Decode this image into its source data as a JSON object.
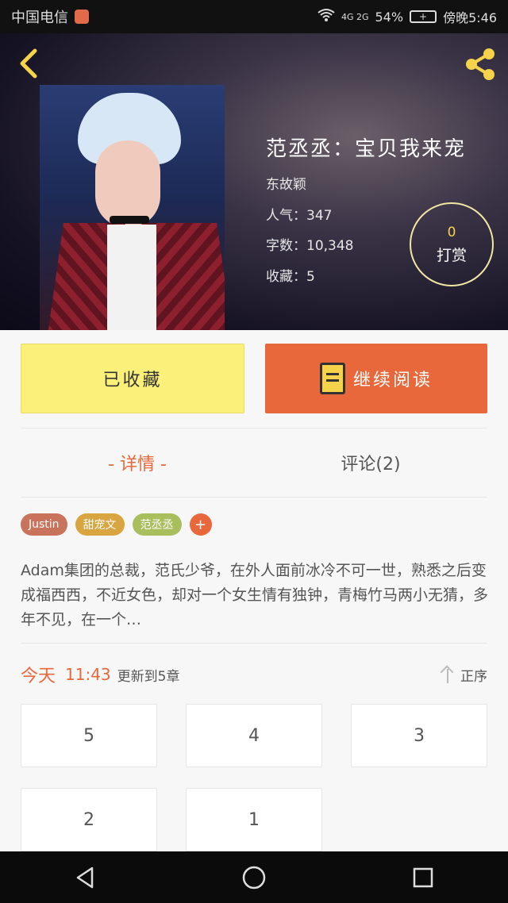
{
  "status_bar": {
    "carrier": "中国电信",
    "network": "4G 2G",
    "battery_percent": "54%",
    "time": "傍晚5:46"
  },
  "book": {
    "title": "范丞丞：宝贝我来宠",
    "author": "东故颖",
    "popularity": "人气：347",
    "word_count": "字数：10,348",
    "favorites": "收藏：5",
    "reward_count": "0",
    "reward_label": "打赏"
  },
  "actions": {
    "collected_label": "已收藏",
    "read_label": "继续阅读"
  },
  "tabs": {
    "detail_label": "- 详情 -",
    "comments_label": "评论(2)"
  },
  "tags": [
    {
      "label": "Justin",
      "color": "#c9735c"
    },
    {
      "label": "甜宠文",
      "color": "#d9a540"
    },
    {
      "label": "范丞丞",
      "color": "#a9be5c"
    }
  ],
  "tag_add_label": "+",
  "summary": "Adam集团的总裁，范氏少爷，在外人面前冰冷不可一世，熟悉之后变成福西西，不近女色，却对一个女生情有独钟，青梅竹马两小无猜，多年不见，在一个…",
  "update": {
    "day": "今天",
    "time": "11:43",
    "text": "更新到5章",
    "sort_label": "正序"
  },
  "chapters": [
    "5",
    "4",
    "3",
    "2",
    "1"
  ],
  "colors": {
    "accent": "#e8673b",
    "collected_bg": "#fbf07a",
    "reward_ring": "#f2e7a2"
  }
}
